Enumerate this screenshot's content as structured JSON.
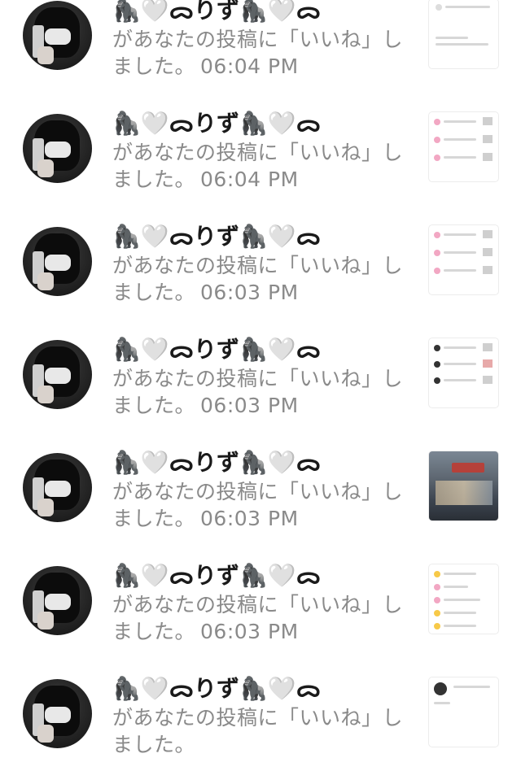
{
  "notifications": [
    {
      "user_name": "🦍🤍ᯅりず🦍🤍ᯅ",
      "message_text": "があなたの投稿に「いいね」しました。",
      "time": "06:04 PM",
      "thumbnail": "insights-card-icon"
    },
    {
      "user_name": "🦍🤍ᯅりず🦍🤍ᯅ",
      "message_text": "があなたの投稿に「いいね」しました。",
      "time": "06:04 PM",
      "thumbnail": "notification-list-icon"
    },
    {
      "user_name": "🦍🤍ᯅりず🦍🤍ᯅ",
      "message_text": "があなたの投稿に「いいね」しました。",
      "time": "06:03 PM",
      "thumbnail": "notification-list-icon"
    },
    {
      "user_name": "🦍🤍ᯅりず🦍🤍ᯅ",
      "message_text": "があなたの投稿に「いいね」しました。",
      "time": "06:03 PM",
      "thumbnail": "notification-list-icon"
    },
    {
      "user_name": "🦍🤍ᯅりず🦍🤍ᯅ",
      "message_text": "があなたの投稿に「いいね」しました。",
      "time": "06:03 PM",
      "thumbnail": "storefront-photo"
    },
    {
      "user_name": "🦍🤍ᯅりず🦍🤍ᯅ",
      "message_text": "があなたの投稿に「いいね」しました。",
      "time": "06:03 PM",
      "thumbnail": "settings-menu-icon"
    },
    {
      "user_name": "🦍🤍ᯅりず🦍🤍ᯅ",
      "message_text": "があなたの投稿に「いいね」しました。",
      "time": "",
      "thumbnail": "profile-card-icon"
    }
  ]
}
